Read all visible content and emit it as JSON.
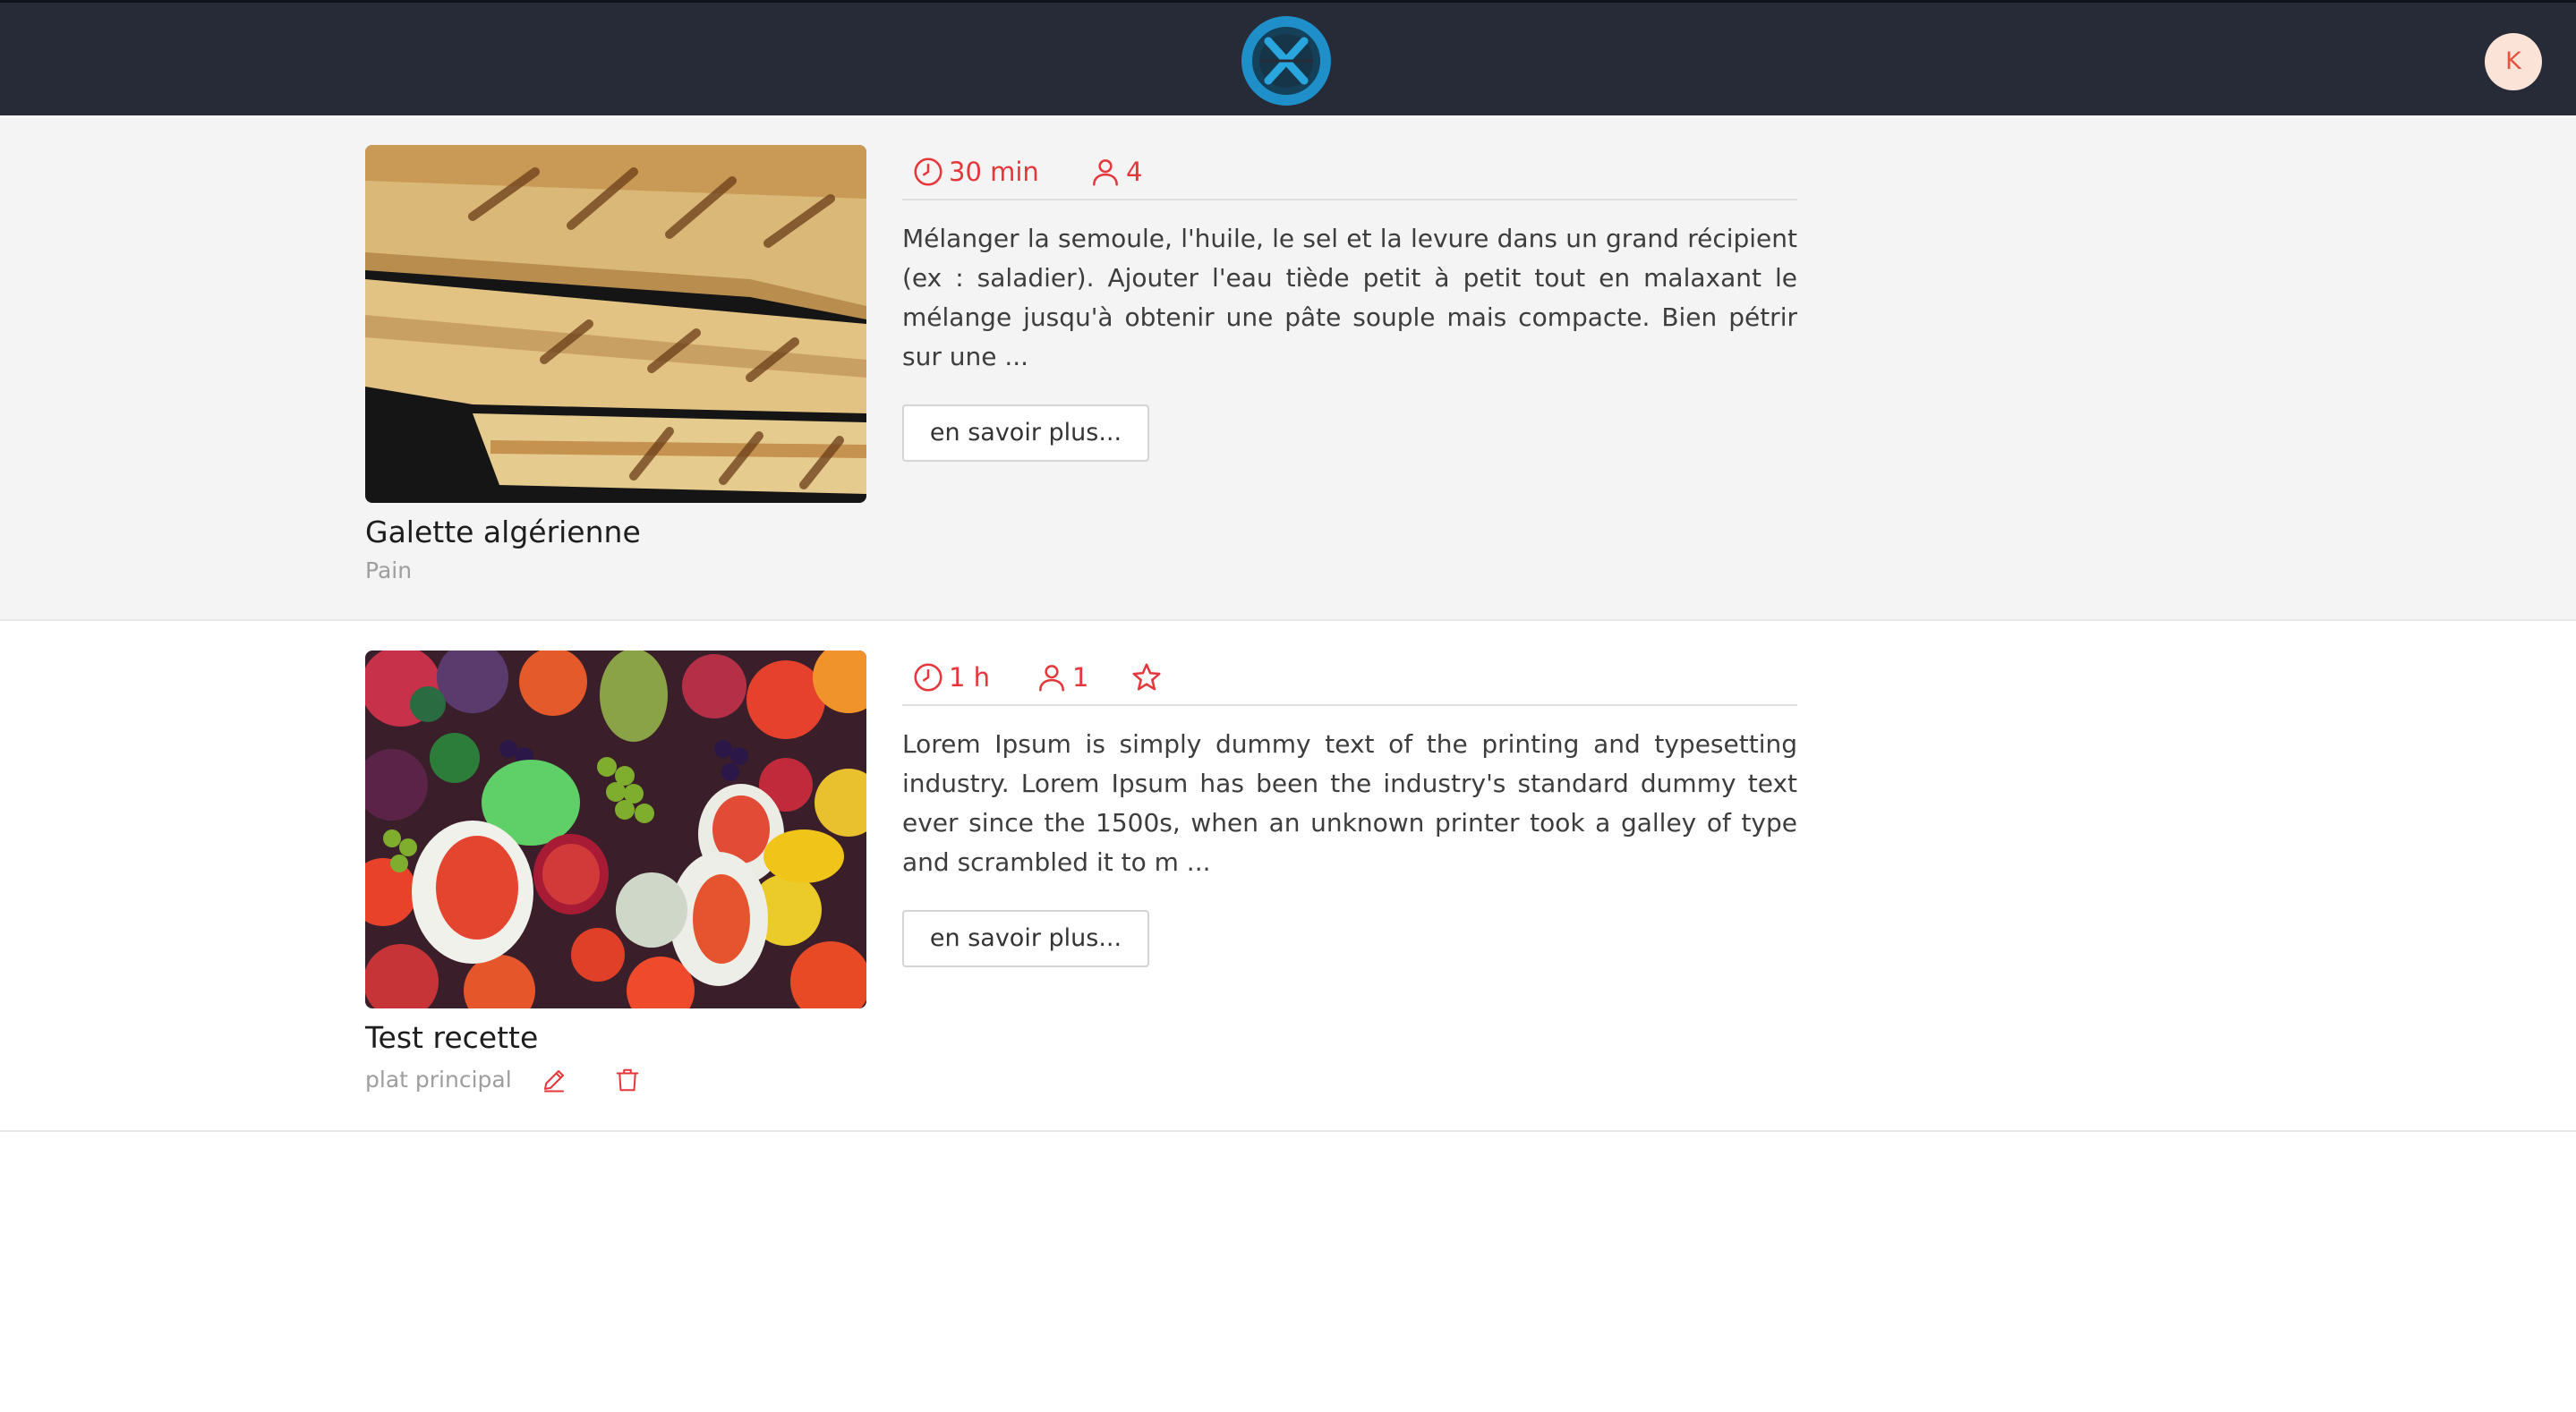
{
  "header": {
    "avatar_letter": "K",
    "logo_icon": "crossed-utensils-logo"
  },
  "colors": {
    "topbar": "#262b37",
    "accent": "#e5373b",
    "avatar_bg": "#fbe3d8",
    "logo_blue": "#1e8fc8"
  },
  "recipes": [
    {
      "title": "Galette algérienne",
      "category": "Pain",
      "time": "30 min",
      "servings": "4",
      "description": "Mélanger la semoule, l'huile, le sel et la levure dans un grand récipient (ex : saladier). Ajouter l'eau tiède petit à petit tout en malaxant le mélange jusqu'à obtenir une pâte souple mais compacte. Bien pétrir sur une ...",
      "more_label": "en savoir plus...",
      "image": "flatbread-photo",
      "favorite": false,
      "editable": false
    },
    {
      "title": "Test recette",
      "category": "plat principal",
      "time": "1 h",
      "servings": "1",
      "description": "Lorem Ipsum is simply dummy text of the printing and typesetting industry. Lorem Ipsum has been the industry's standard dummy text ever since the 1500s, when an unknown printer took a galley of type and scrambled it to m ...",
      "more_label": "en savoir plus...",
      "image": "fruits-photo",
      "favorite": true,
      "editable": true
    }
  ]
}
